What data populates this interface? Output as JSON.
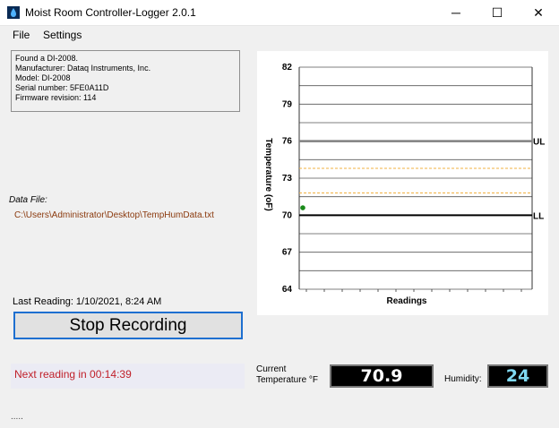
{
  "window": {
    "title": "Moist Room Controller-Logger  2.0.1",
    "minimize_glyph": "─",
    "maximize_glyph": "☐",
    "close_glyph": "✕",
    "icon": "water-drop-icon"
  },
  "menu": {
    "items": [
      {
        "label": "File"
      },
      {
        "label": "Settings"
      }
    ]
  },
  "device_info": {
    "lines": [
      "Found a DI-2008.",
      "Manufacturer: Dataq Instruments, Inc.",
      "Model: DI-2008",
      "Serial number: 5FE0A11D",
      "Firmware revision: 114"
    ]
  },
  "data_file": {
    "label": "Data File:",
    "path": "C:\\Users\\Administrator\\Desktop\\TempHumData.txt"
  },
  "last_reading": "Last Reading: 1/10/2021, 8:24 AM",
  "stop_button": "Stop Recording",
  "next_reading": "Next reading in 00:14:39",
  "status_dots": ".....",
  "current_temp": {
    "label_line1": "Current",
    "label_line2": "Temperature °F",
    "value": "70.9"
  },
  "humidity": {
    "label": "Humidity:",
    "value": "24"
  },
  "chart_data": {
    "type": "scatter",
    "xlabel": "Readings",
    "ylabel": "Temperature (oF)",
    "ylim": [
      64,
      82
    ],
    "yticks": [
      "82",
      "79",
      "76",
      "73",
      "70",
      "67",
      "64"
    ],
    "grid": true,
    "points": [
      {
        "x": 0,
        "y": 70.6
      }
    ],
    "upper_limit": {
      "value": 76,
      "label": "UL"
    },
    "lower_limit": {
      "value": 70,
      "label": "LL"
    },
    "dashed_bands": [
      73.8,
      71.8
    ],
    "colors": {
      "upper_limit": "#808080",
      "lower_limit": "#000000",
      "dashed": "#f0b040",
      "point": "#1a8a1a",
      "grid": "#555555"
    }
  }
}
